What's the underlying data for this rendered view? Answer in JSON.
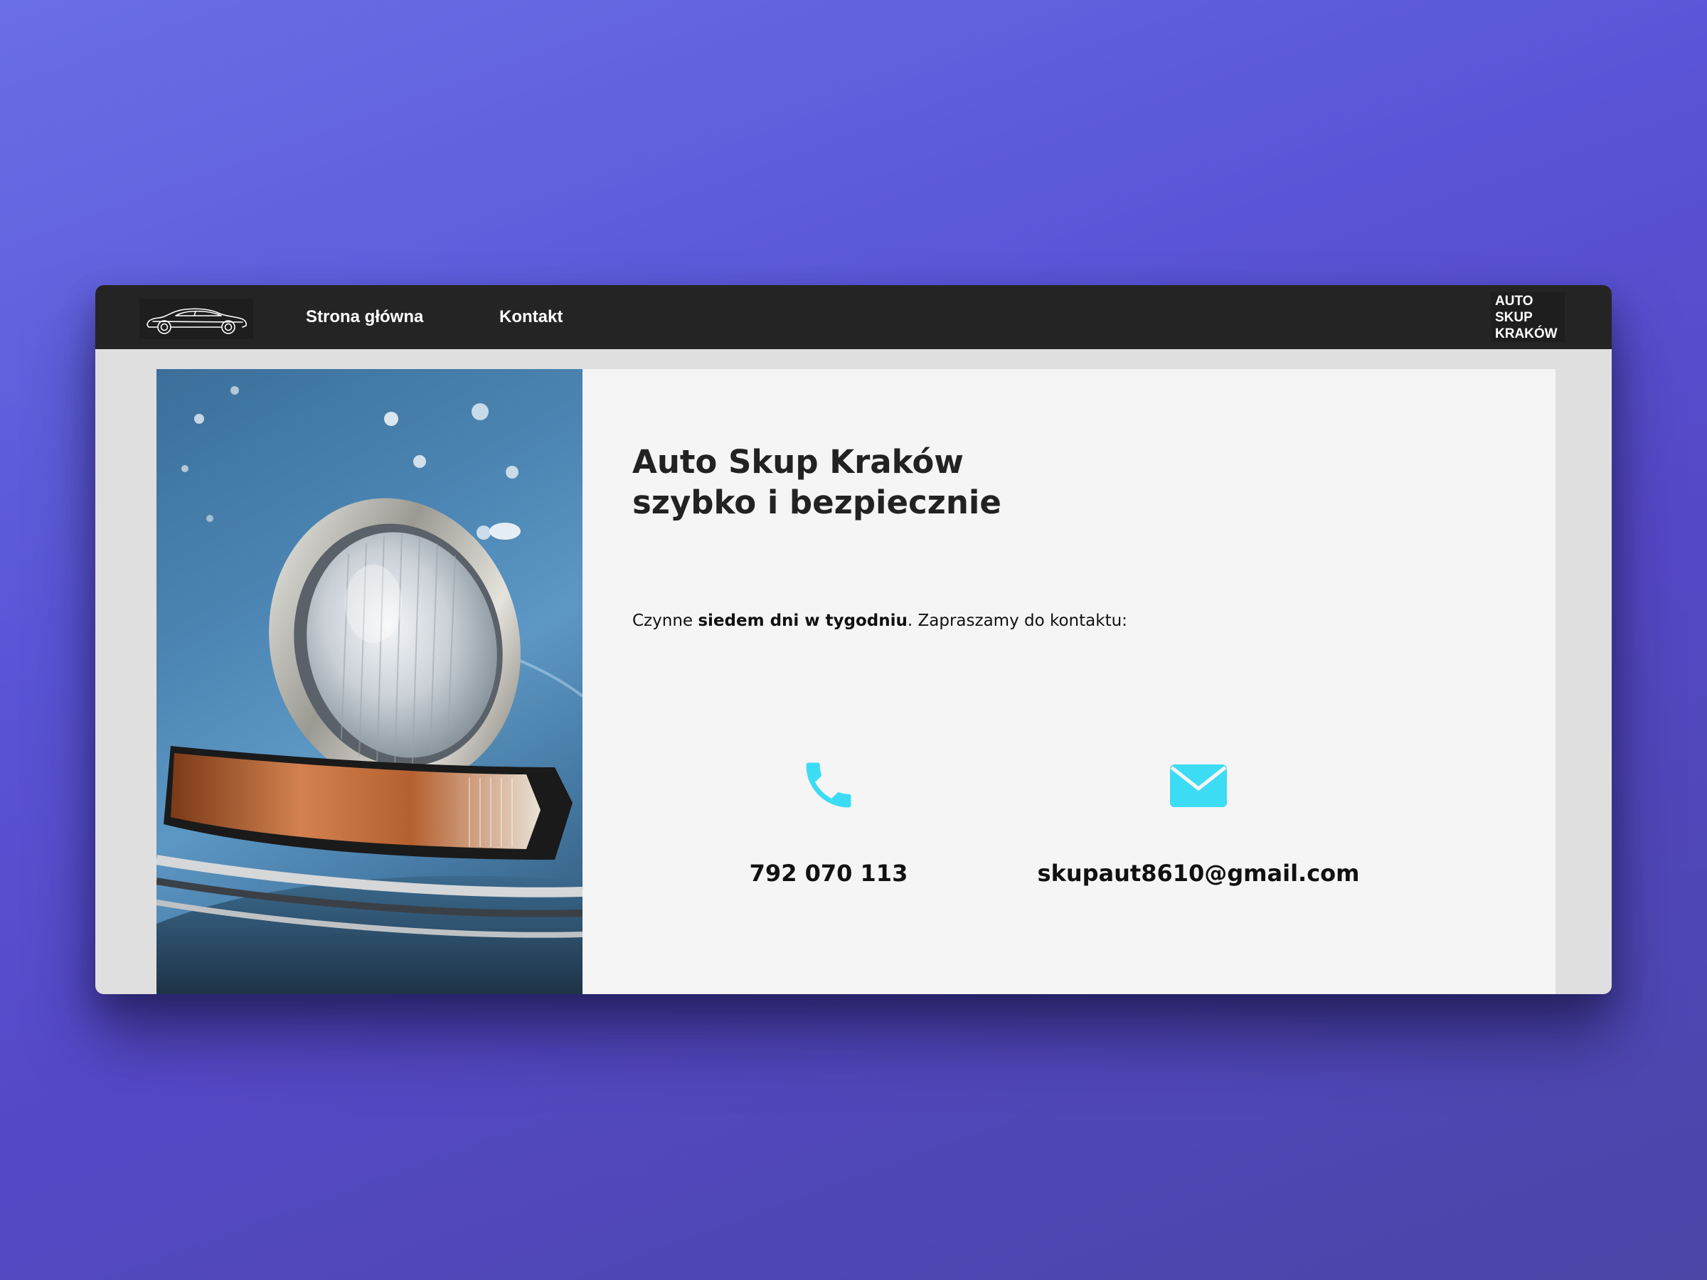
{
  "nav": {
    "links": [
      {
        "label": "Strona główna"
      },
      {
        "label": "Kontakt"
      }
    ],
    "brand_lines": [
      "AUTO",
      "SKUP",
      "KRAKÓW"
    ]
  },
  "hero": {
    "title_line1": "Auto Skup Kraków",
    "title_line2_prefix": "szybko i ",
    "title_line2_bold": "bezpiecznie",
    "tagline_prefix": "Czynne ",
    "tagline_bold": "siedem dni w tygodniu",
    "tagline_suffix": ". Zapraszamy do kontaktu:"
  },
  "contacts": {
    "phone": "792 070 113",
    "email": "skupaut8610@gmail.com"
  },
  "colors": {
    "navbar": "#242424",
    "accent_icon": "#3ddcf5",
    "card": "#f5f5f5",
    "frame": "#e0dfe0"
  },
  "icons": [
    "car-logo-icon",
    "phone-icon",
    "envelope-icon"
  ]
}
